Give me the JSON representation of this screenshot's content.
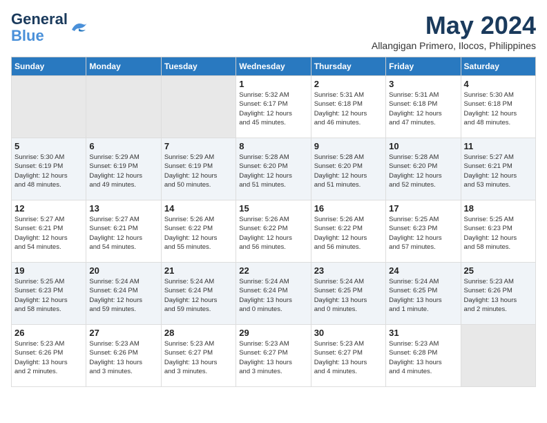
{
  "header": {
    "logo_line1": "General",
    "logo_line2": "Blue",
    "month_year": "May 2024",
    "location": "Allangigan Primero, Ilocos, Philippines"
  },
  "days_of_week": [
    "Sunday",
    "Monday",
    "Tuesday",
    "Wednesday",
    "Thursday",
    "Friday",
    "Saturday"
  ],
  "weeks": [
    [
      {
        "day": "",
        "info": ""
      },
      {
        "day": "",
        "info": ""
      },
      {
        "day": "",
        "info": ""
      },
      {
        "day": "1",
        "info": "Sunrise: 5:32 AM\nSunset: 6:17 PM\nDaylight: 12 hours\nand 45 minutes."
      },
      {
        "day": "2",
        "info": "Sunrise: 5:31 AM\nSunset: 6:18 PM\nDaylight: 12 hours\nand 46 minutes."
      },
      {
        "day": "3",
        "info": "Sunrise: 5:31 AM\nSunset: 6:18 PM\nDaylight: 12 hours\nand 47 minutes."
      },
      {
        "day": "4",
        "info": "Sunrise: 5:30 AM\nSunset: 6:18 PM\nDaylight: 12 hours\nand 48 minutes."
      }
    ],
    [
      {
        "day": "5",
        "info": "Sunrise: 5:30 AM\nSunset: 6:19 PM\nDaylight: 12 hours\nand 48 minutes."
      },
      {
        "day": "6",
        "info": "Sunrise: 5:29 AM\nSunset: 6:19 PM\nDaylight: 12 hours\nand 49 minutes."
      },
      {
        "day": "7",
        "info": "Sunrise: 5:29 AM\nSunset: 6:19 PM\nDaylight: 12 hours\nand 50 minutes."
      },
      {
        "day": "8",
        "info": "Sunrise: 5:28 AM\nSunset: 6:20 PM\nDaylight: 12 hours\nand 51 minutes."
      },
      {
        "day": "9",
        "info": "Sunrise: 5:28 AM\nSunset: 6:20 PM\nDaylight: 12 hours\nand 51 minutes."
      },
      {
        "day": "10",
        "info": "Sunrise: 5:28 AM\nSunset: 6:20 PM\nDaylight: 12 hours\nand 52 minutes."
      },
      {
        "day": "11",
        "info": "Sunrise: 5:27 AM\nSunset: 6:21 PM\nDaylight: 12 hours\nand 53 minutes."
      }
    ],
    [
      {
        "day": "12",
        "info": "Sunrise: 5:27 AM\nSunset: 6:21 PM\nDaylight: 12 hours\nand 54 minutes."
      },
      {
        "day": "13",
        "info": "Sunrise: 5:27 AM\nSunset: 6:21 PM\nDaylight: 12 hours\nand 54 minutes."
      },
      {
        "day": "14",
        "info": "Sunrise: 5:26 AM\nSunset: 6:22 PM\nDaylight: 12 hours\nand 55 minutes."
      },
      {
        "day": "15",
        "info": "Sunrise: 5:26 AM\nSunset: 6:22 PM\nDaylight: 12 hours\nand 56 minutes."
      },
      {
        "day": "16",
        "info": "Sunrise: 5:26 AM\nSunset: 6:22 PM\nDaylight: 12 hours\nand 56 minutes."
      },
      {
        "day": "17",
        "info": "Sunrise: 5:25 AM\nSunset: 6:23 PM\nDaylight: 12 hours\nand 57 minutes."
      },
      {
        "day": "18",
        "info": "Sunrise: 5:25 AM\nSunset: 6:23 PM\nDaylight: 12 hours\nand 58 minutes."
      }
    ],
    [
      {
        "day": "19",
        "info": "Sunrise: 5:25 AM\nSunset: 6:23 PM\nDaylight: 12 hours\nand 58 minutes."
      },
      {
        "day": "20",
        "info": "Sunrise: 5:24 AM\nSunset: 6:24 PM\nDaylight: 12 hours\nand 59 minutes."
      },
      {
        "day": "21",
        "info": "Sunrise: 5:24 AM\nSunset: 6:24 PM\nDaylight: 12 hours\nand 59 minutes."
      },
      {
        "day": "22",
        "info": "Sunrise: 5:24 AM\nSunset: 6:24 PM\nDaylight: 13 hours\nand 0 minutes."
      },
      {
        "day": "23",
        "info": "Sunrise: 5:24 AM\nSunset: 6:25 PM\nDaylight: 13 hours\nand 0 minutes."
      },
      {
        "day": "24",
        "info": "Sunrise: 5:24 AM\nSunset: 6:25 PM\nDaylight: 13 hours\nand 1 minute."
      },
      {
        "day": "25",
        "info": "Sunrise: 5:23 AM\nSunset: 6:26 PM\nDaylight: 13 hours\nand 2 minutes."
      }
    ],
    [
      {
        "day": "26",
        "info": "Sunrise: 5:23 AM\nSunset: 6:26 PM\nDaylight: 13 hours\nand 2 minutes."
      },
      {
        "day": "27",
        "info": "Sunrise: 5:23 AM\nSunset: 6:26 PM\nDaylight: 13 hours\nand 3 minutes."
      },
      {
        "day": "28",
        "info": "Sunrise: 5:23 AM\nSunset: 6:27 PM\nDaylight: 13 hours\nand 3 minutes."
      },
      {
        "day": "29",
        "info": "Sunrise: 5:23 AM\nSunset: 6:27 PM\nDaylight: 13 hours\nand 3 minutes."
      },
      {
        "day": "30",
        "info": "Sunrise: 5:23 AM\nSunset: 6:27 PM\nDaylight: 13 hours\nand 4 minutes."
      },
      {
        "day": "31",
        "info": "Sunrise: 5:23 AM\nSunset: 6:28 PM\nDaylight: 13 hours\nand 4 minutes."
      },
      {
        "day": "",
        "info": ""
      }
    ]
  ]
}
